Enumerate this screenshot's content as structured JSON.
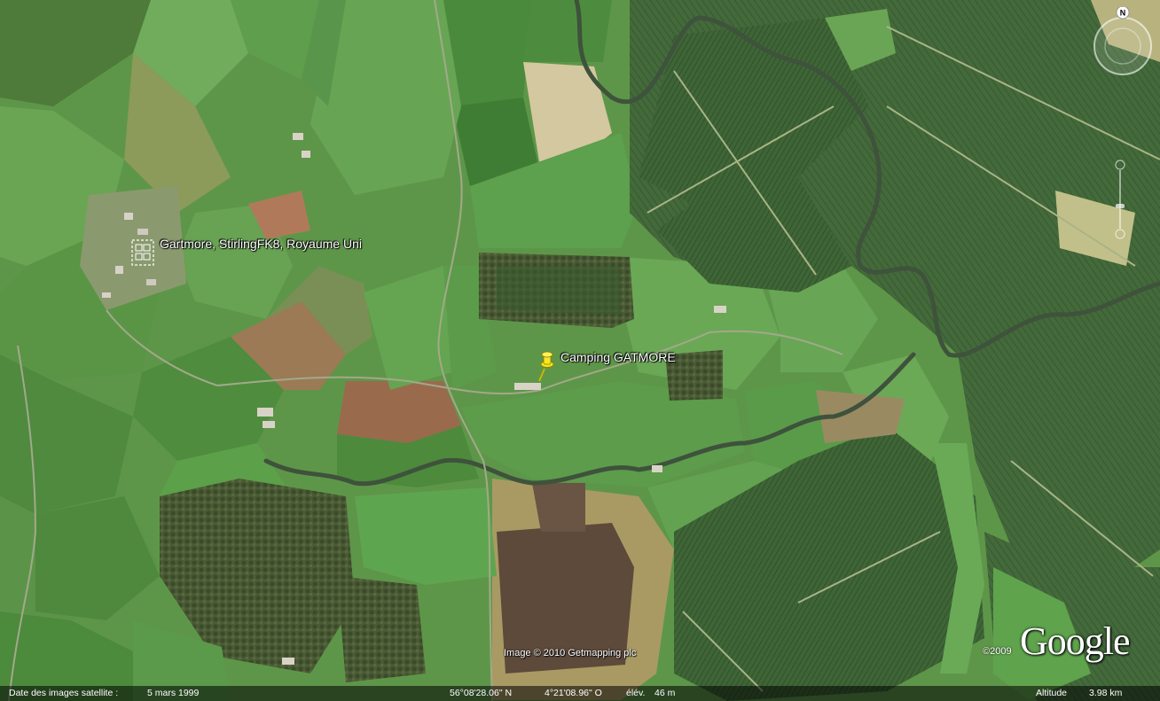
{
  "map": {
    "places": {
      "gartmore": "Gartmore, StirlingFK8, Royaume Uni",
      "camping": "Camping GATMORE"
    },
    "compass": {
      "north_label": "N"
    },
    "icons": [
      "compass-icon",
      "pushpin-icon",
      "place-icon",
      "zoom-slider"
    ]
  },
  "branding": {
    "logo_text": "Google",
    "copyright_year": "©2009",
    "image_credit": "Image © 2010 Getmapping plc"
  },
  "status_bar": {
    "date_label": "Date des images satellite :",
    "date_value": "5 mars 1999",
    "latitude": "56°08'28.06\" N",
    "longitude": "4°21'08.96\" O",
    "elevation_label": "élév.",
    "elevation_value": "46 m",
    "altitude_label": "Altitude",
    "altitude_value": "3.98 km"
  },
  "colors": {
    "pasture": "#5f9a4a",
    "pasture_light": "#78ad5c",
    "forest_dark": "#2d4e2a",
    "forest_plantation": "#486d3e",
    "bare_field": "#c9b98a",
    "moor": "#5b4a3a",
    "river": "#4d5f4a",
    "pushpin": "#f3e21b"
  }
}
